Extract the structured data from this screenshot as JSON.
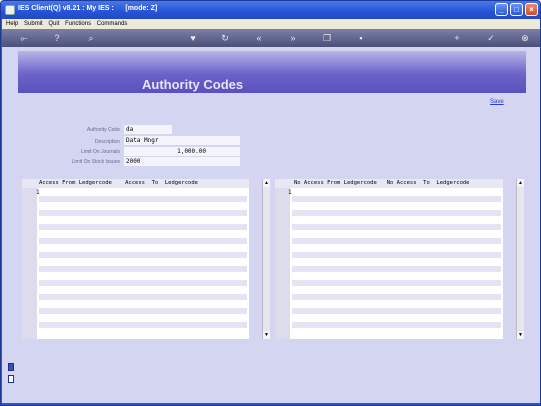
{
  "window": {
    "title": "IES Client(Q) v8.21 : My IES :      [mode: Z]"
  },
  "menu": [
    "Help",
    "Submit",
    "Quit",
    "Functions",
    "Commands"
  ],
  "toolbar_icons": [
    "key-icon",
    "help-icon",
    "search-icon",
    "heart-icon",
    "refresh-icon",
    "rewind-icon",
    "fast-forward-icon",
    "copy-icon",
    "delete-icon",
    "plus-icon",
    "check-icon",
    "close-icon"
  ],
  "toolbar_glyphs": [
    "⟜",
    "?",
    "⌕",
    "♥",
    "↻",
    "«",
    "»",
    "❐",
    "▪",
    "+",
    "✓",
    "⊗"
  ],
  "page": {
    "title": "Authority Codes",
    "save_label": "Save"
  },
  "form": {
    "authority_code": {
      "label": "Authority Code",
      "value": "da"
    },
    "description": {
      "label": "Description",
      "value": "Data Mngr"
    },
    "limit_journals": {
      "label": "Limit On Journals",
      "value": "1,000.00"
    },
    "limit_stock_issues": {
      "label": "Limit On Stock Issues",
      "value": "2000"
    }
  },
  "access_grid": {
    "header": "Access From Ledgercode    Access  To  Ledgercode",
    "first_row_num": "1"
  },
  "noaccess_grid": {
    "header": "No Access From Ledgercode   No Access  To  Ledgercode",
    "first_row_num": "1"
  },
  "scroll": {
    "up": "▲",
    "down": "▼"
  }
}
